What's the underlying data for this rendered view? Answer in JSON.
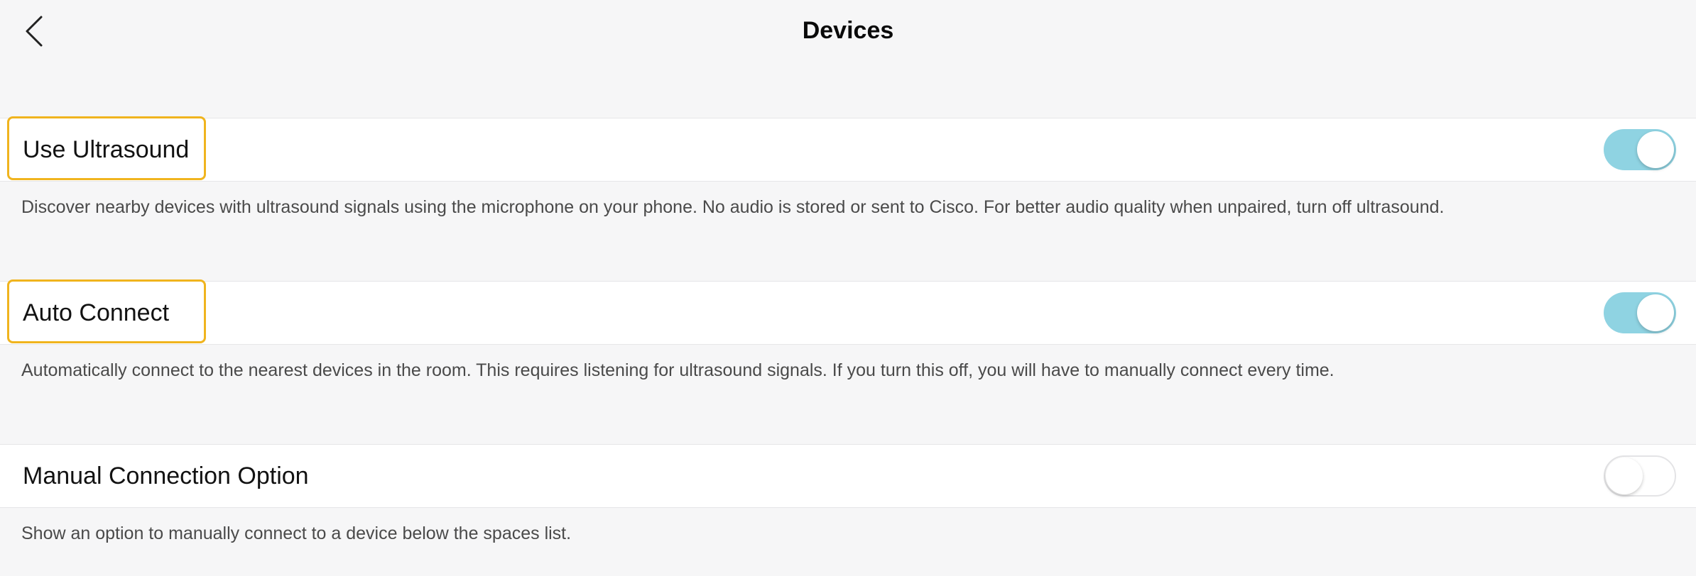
{
  "header": {
    "title": "Devices",
    "back_icon": "chevron-left-icon"
  },
  "colors": {
    "toggle_on": "#8fd3e2",
    "highlight": "#f0b41e",
    "background": "#f6f6f7"
  },
  "settings": [
    {
      "label": "Use Ultrasound",
      "enabled": true,
      "highlighted": true,
      "description": "Discover nearby devices with ultrasound signals using the microphone on your phone. No audio is stored or sent to Cisco. For better audio quality when unpaired, turn off ultrasound."
    },
    {
      "label": "Auto Connect",
      "enabled": true,
      "highlighted": true,
      "description": "Automatically connect to the nearest devices in the room. This requires listening for ultrasound signals. If you turn this off, you will have to manually connect every time."
    },
    {
      "label": "Manual Connection Option",
      "enabled": false,
      "highlighted": false,
      "description": "Show an option to manually connect to a device below the spaces list."
    }
  ]
}
